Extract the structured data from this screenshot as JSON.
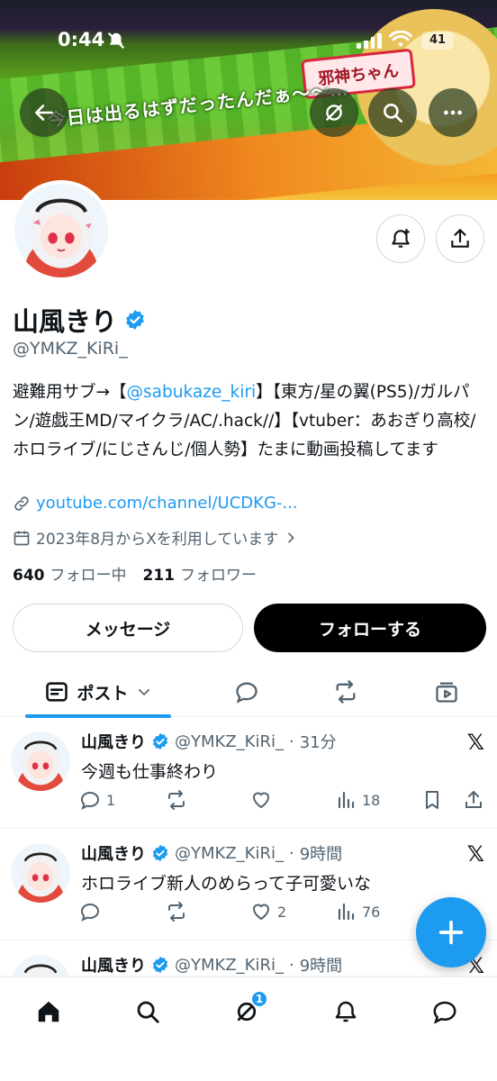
{
  "status_bar": {
    "time": "0:44",
    "battery": "41"
  },
  "banner": {
    "caption": "今日は出るはずだったんだぁ〜〜…",
    "tag": "邪神ちゃん"
  },
  "profile": {
    "name": "山風きり",
    "handle": "@YMKZ_KiRi_",
    "bio_before": "避難用サブ→【",
    "bio_mention": "@sabukaze_kiri",
    "bio_after": "】【東方/星の翼(PS5)/ガルパン/遊戯王MD/マイクラ/AC/.hack//】【vtuber：あおぎり高校/ホロライブ/にじさんじ/個人勢】たまに動画投稿してます",
    "link": "youtube.com/channel/UCDKG-...",
    "joined": "2023年8月からXを利用しています",
    "following_count": "640",
    "following_label": "フォロー中",
    "followers_count": "211",
    "followers_label": "フォロワー"
  },
  "buttons": {
    "message": "メッセージ",
    "follow": "フォローする"
  },
  "tabs": {
    "posts_label": "ポスト"
  },
  "posts": [
    {
      "name": "山風きり",
      "handle": "@YMKZ_KiRi_",
      "time": "31分",
      "text": "今週も仕事終わり",
      "replies": "1",
      "reposts": "",
      "likes": "",
      "views": "18"
    },
    {
      "name": "山風きり",
      "handle": "@YMKZ_KiRi_",
      "time": "9時間",
      "text": "ホロライブ新人のめらって子可愛いな",
      "replies": "",
      "reposts": "",
      "likes": "2",
      "views": "76"
    },
    {
      "name": "山風きり",
      "handle": "@YMKZ_KiRi_",
      "time": "9時間",
      "text": ""
    }
  ],
  "nav": {
    "grok_badge": "1"
  },
  "colors": {
    "accent": "#1d9bf0",
    "text": "#0f1419",
    "muted": "#536471"
  }
}
